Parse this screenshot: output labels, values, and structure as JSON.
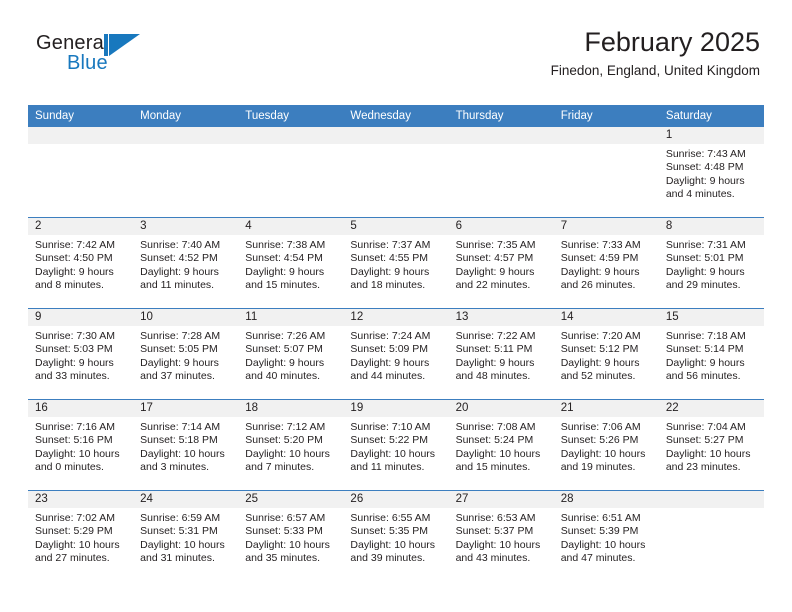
{
  "brand": {
    "name_part1": "General",
    "name_part2": "Blue",
    "mark": "blue-flag-logo"
  },
  "header": {
    "title": "February 2025",
    "subtitle": "Finedon, England, United Kingdom"
  },
  "colors": {
    "header_blue": "#3c7ebf",
    "brand_blue": "#1878be",
    "day_band_gray": "#f1f1f1",
    "text": "#231f20"
  },
  "weekday_headers": [
    "Sunday",
    "Monday",
    "Tuesday",
    "Wednesday",
    "Thursday",
    "Friday",
    "Saturday"
  ],
  "weeks": [
    [
      {
        "day": "",
        "sunrise": "",
        "sunset": "",
        "daylight_line1": "",
        "daylight_line2": ""
      },
      {
        "day": "",
        "sunrise": "",
        "sunset": "",
        "daylight_line1": "",
        "daylight_line2": ""
      },
      {
        "day": "",
        "sunrise": "",
        "sunset": "",
        "daylight_line1": "",
        "daylight_line2": ""
      },
      {
        "day": "",
        "sunrise": "",
        "sunset": "",
        "daylight_line1": "",
        "daylight_line2": ""
      },
      {
        "day": "",
        "sunrise": "",
        "sunset": "",
        "daylight_line1": "",
        "daylight_line2": ""
      },
      {
        "day": "",
        "sunrise": "",
        "sunset": "",
        "daylight_line1": "",
        "daylight_line2": ""
      },
      {
        "day": "1",
        "sunrise": "Sunrise: 7:43 AM",
        "sunset": "Sunset: 4:48 PM",
        "daylight_line1": "Daylight: 9 hours",
        "daylight_line2": "and 4 minutes."
      }
    ],
    [
      {
        "day": "2",
        "sunrise": "Sunrise: 7:42 AM",
        "sunset": "Sunset: 4:50 PM",
        "daylight_line1": "Daylight: 9 hours",
        "daylight_line2": "and 8 minutes."
      },
      {
        "day": "3",
        "sunrise": "Sunrise: 7:40 AM",
        "sunset": "Sunset: 4:52 PM",
        "daylight_line1": "Daylight: 9 hours",
        "daylight_line2": "and 11 minutes."
      },
      {
        "day": "4",
        "sunrise": "Sunrise: 7:38 AM",
        "sunset": "Sunset: 4:54 PM",
        "daylight_line1": "Daylight: 9 hours",
        "daylight_line2": "and 15 minutes."
      },
      {
        "day": "5",
        "sunrise": "Sunrise: 7:37 AM",
        "sunset": "Sunset: 4:55 PM",
        "daylight_line1": "Daylight: 9 hours",
        "daylight_line2": "and 18 minutes."
      },
      {
        "day": "6",
        "sunrise": "Sunrise: 7:35 AM",
        "sunset": "Sunset: 4:57 PM",
        "daylight_line1": "Daylight: 9 hours",
        "daylight_line2": "and 22 minutes."
      },
      {
        "day": "7",
        "sunrise": "Sunrise: 7:33 AM",
        "sunset": "Sunset: 4:59 PM",
        "daylight_line1": "Daylight: 9 hours",
        "daylight_line2": "and 26 minutes."
      },
      {
        "day": "8",
        "sunrise": "Sunrise: 7:31 AM",
        "sunset": "Sunset: 5:01 PM",
        "daylight_line1": "Daylight: 9 hours",
        "daylight_line2": "and 29 minutes."
      }
    ],
    [
      {
        "day": "9",
        "sunrise": "Sunrise: 7:30 AM",
        "sunset": "Sunset: 5:03 PM",
        "daylight_line1": "Daylight: 9 hours",
        "daylight_line2": "and 33 minutes."
      },
      {
        "day": "10",
        "sunrise": "Sunrise: 7:28 AM",
        "sunset": "Sunset: 5:05 PM",
        "daylight_line1": "Daylight: 9 hours",
        "daylight_line2": "and 37 minutes."
      },
      {
        "day": "11",
        "sunrise": "Sunrise: 7:26 AM",
        "sunset": "Sunset: 5:07 PM",
        "daylight_line1": "Daylight: 9 hours",
        "daylight_line2": "and 40 minutes."
      },
      {
        "day": "12",
        "sunrise": "Sunrise: 7:24 AM",
        "sunset": "Sunset: 5:09 PM",
        "daylight_line1": "Daylight: 9 hours",
        "daylight_line2": "and 44 minutes."
      },
      {
        "day": "13",
        "sunrise": "Sunrise: 7:22 AM",
        "sunset": "Sunset: 5:11 PM",
        "daylight_line1": "Daylight: 9 hours",
        "daylight_line2": "and 48 minutes."
      },
      {
        "day": "14",
        "sunrise": "Sunrise: 7:20 AM",
        "sunset": "Sunset: 5:12 PM",
        "daylight_line1": "Daylight: 9 hours",
        "daylight_line2": "and 52 minutes."
      },
      {
        "day": "15",
        "sunrise": "Sunrise: 7:18 AM",
        "sunset": "Sunset: 5:14 PM",
        "daylight_line1": "Daylight: 9 hours",
        "daylight_line2": "and 56 minutes."
      }
    ],
    [
      {
        "day": "16",
        "sunrise": "Sunrise: 7:16 AM",
        "sunset": "Sunset: 5:16 PM",
        "daylight_line1": "Daylight: 10 hours",
        "daylight_line2": "and 0 minutes."
      },
      {
        "day": "17",
        "sunrise": "Sunrise: 7:14 AM",
        "sunset": "Sunset: 5:18 PM",
        "daylight_line1": "Daylight: 10 hours",
        "daylight_line2": "and 3 minutes."
      },
      {
        "day": "18",
        "sunrise": "Sunrise: 7:12 AM",
        "sunset": "Sunset: 5:20 PM",
        "daylight_line1": "Daylight: 10 hours",
        "daylight_line2": "and 7 minutes."
      },
      {
        "day": "19",
        "sunrise": "Sunrise: 7:10 AM",
        "sunset": "Sunset: 5:22 PM",
        "daylight_line1": "Daylight: 10 hours",
        "daylight_line2": "and 11 minutes."
      },
      {
        "day": "20",
        "sunrise": "Sunrise: 7:08 AM",
        "sunset": "Sunset: 5:24 PM",
        "daylight_line1": "Daylight: 10 hours",
        "daylight_line2": "and 15 minutes."
      },
      {
        "day": "21",
        "sunrise": "Sunrise: 7:06 AM",
        "sunset": "Sunset: 5:26 PM",
        "daylight_line1": "Daylight: 10 hours",
        "daylight_line2": "and 19 minutes."
      },
      {
        "day": "22",
        "sunrise": "Sunrise: 7:04 AM",
        "sunset": "Sunset: 5:27 PM",
        "daylight_line1": "Daylight: 10 hours",
        "daylight_line2": "and 23 minutes."
      }
    ],
    [
      {
        "day": "23",
        "sunrise": "Sunrise: 7:02 AM",
        "sunset": "Sunset: 5:29 PM",
        "daylight_line1": "Daylight: 10 hours",
        "daylight_line2": "and 27 minutes."
      },
      {
        "day": "24",
        "sunrise": "Sunrise: 6:59 AM",
        "sunset": "Sunset: 5:31 PM",
        "daylight_line1": "Daylight: 10 hours",
        "daylight_line2": "and 31 minutes."
      },
      {
        "day": "25",
        "sunrise": "Sunrise: 6:57 AM",
        "sunset": "Sunset: 5:33 PM",
        "daylight_line1": "Daylight: 10 hours",
        "daylight_line2": "and 35 minutes."
      },
      {
        "day": "26",
        "sunrise": "Sunrise: 6:55 AM",
        "sunset": "Sunset: 5:35 PM",
        "daylight_line1": "Daylight: 10 hours",
        "daylight_line2": "and 39 minutes."
      },
      {
        "day": "27",
        "sunrise": "Sunrise: 6:53 AM",
        "sunset": "Sunset: 5:37 PM",
        "daylight_line1": "Daylight: 10 hours",
        "daylight_line2": "and 43 minutes."
      },
      {
        "day": "28",
        "sunrise": "Sunrise: 6:51 AM",
        "sunset": "Sunset: 5:39 PM",
        "daylight_line1": "Daylight: 10 hours",
        "daylight_line2": "and 47 minutes."
      },
      {
        "day": "",
        "sunrise": "",
        "sunset": "",
        "daylight_line1": "",
        "daylight_line2": ""
      }
    ]
  ]
}
